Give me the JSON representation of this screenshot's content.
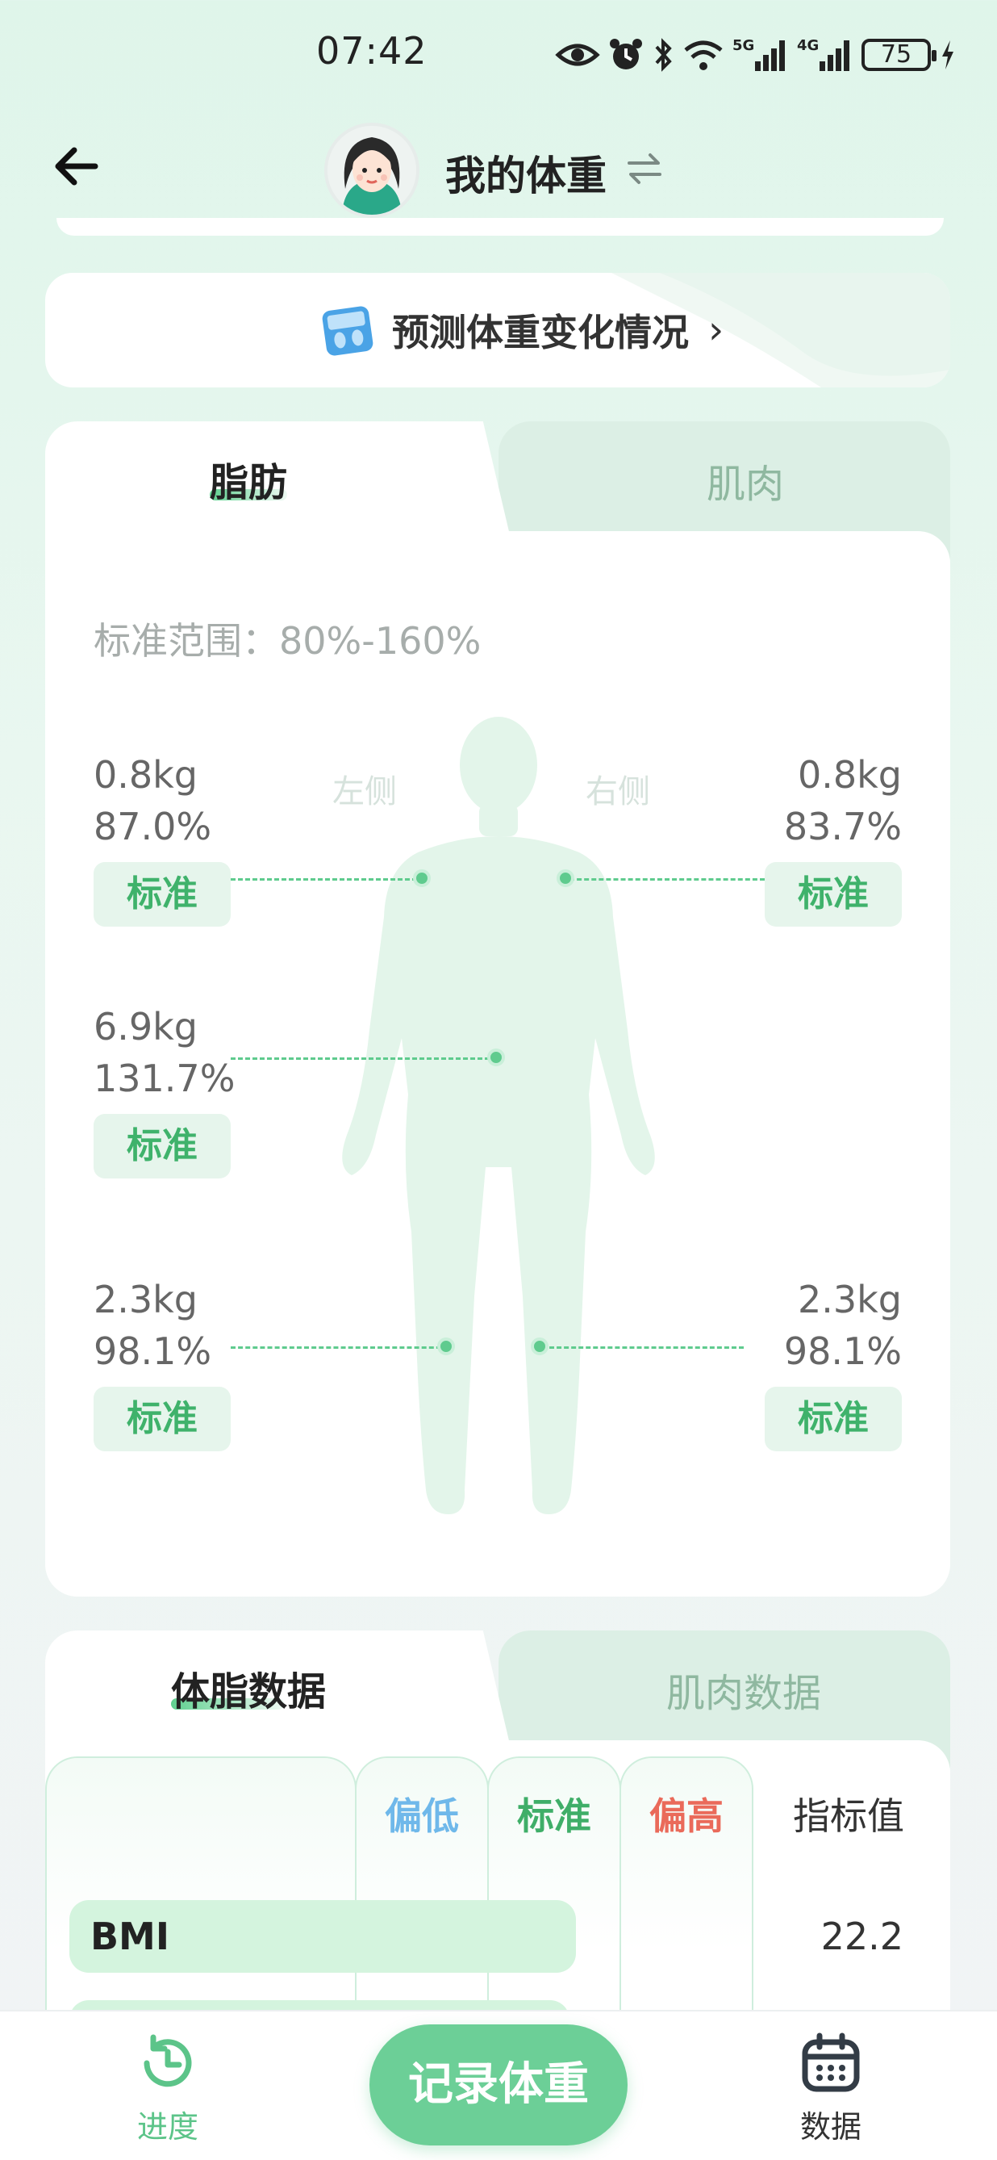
{
  "status_bar": {
    "time": "07:42",
    "icons": [
      "eye-icon",
      "alarm-icon",
      "bluetooth-icon",
      "wifi-icon",
      "signal-5g-icon",
      "signal-4g-icon",
      "battery-icon",
      "charging-icon"
    ],
    "net_5g": "5G",
    "net_4g": "4G",
    "battery": "75"
  },
  "header": {
    "title": "我的体重",
    "switch_symbol": "⇌"
  },
  "predict_banner": {
    "text": "预测体重变化情况",
    "chevron": "›"
  },
  "composition": {
    "tabs": [
      {
        "label": "脂肪",
        "active": true
      },
      {
        "label": "肌肉",
        "active": false
      }
    ],
    "standard_range": "标准范围：80%-160%",
    "side_left": "左侧",
    "side_right": "右侧",
    "left_arm": {
      "weight": "0.8kg",
      "percent": "87.0%",
      "status": "标准"
    },
    "right_arm": {
      "weight": "0.8kg",
      "percent": "83.7%",
      "status": "标准"
    },
    "trunk": {
      "weight": "6.9kg",
      "percent": "131.7%",
      "status": "标准"
    },
    "left_leg": {
      "weight": "2.3kg",
      "percent": "98.1%",
      "status": "标准"
    },
    "right_leg": {
      "weight": "2.3kg",
      "percent": "98.1%",
      "status": "标准"
    }
  },
  "data_section": {
    "tabs": [
      {
        "label": "体脂数据",
        "active": true
      },
      {
        "label": "肌肉数据",
        "active": false
      }
    ],
    "columns": {
      "low": "偏低",
      "standard": "标准",
      "high": "偏高",
      "value": "指标值"
    },
    "rows": [
      {
        "label": "BMI",
        "value": "22.2"
      }
    ]
  },
  "bottom_nav": {
    "progress_label": "进度",
    "record_label": "记录体重",
    "data_label": "数据"
  },
  "colors": {
    "accent_green": "#6ccf97",
    "status_green": "#3fb26b",
    "low_blue": "#6fb8ea",
    "high_red": "#ea6a5a"
  }
}
